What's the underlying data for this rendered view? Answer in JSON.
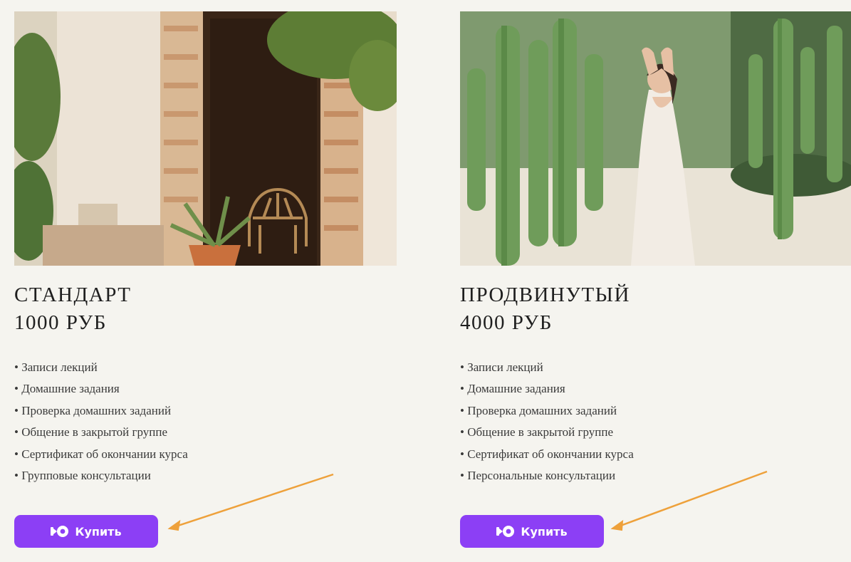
{
  "accent_color": "#8c3ff5",
  "arrow_color": "#eea13b",
  "plans": [
    {
      "name": "СТАНДАРТ",
      "price": "1000 РУБ",
      "features": [
        "Записи лекций",
        "Домашние задания",
        "Проверка домашних заданий",
        "Общение в закрытой группе",
        "Сертификат об окончании курса",
        "Групповые консультации"
      ],
      "button_label": "Купить",
      "button_icon": "yoomoney-logo-icon"
    },
    {
      "name": "ПРОДВИНУТЫЙ",
      "price": "4000 РУБ",
      "features": [
        "Записи лекций",
        "Домашние задания",
        "Проверка домашних заданий",
        "Общение в закрытой группе",
        "Сертификат об окончании курса",
        "Персональные консультации"
      ],
      "button_label": "Купить",
      "button_icon": "yoomoney-logo-icon"
    }
  ]
}
